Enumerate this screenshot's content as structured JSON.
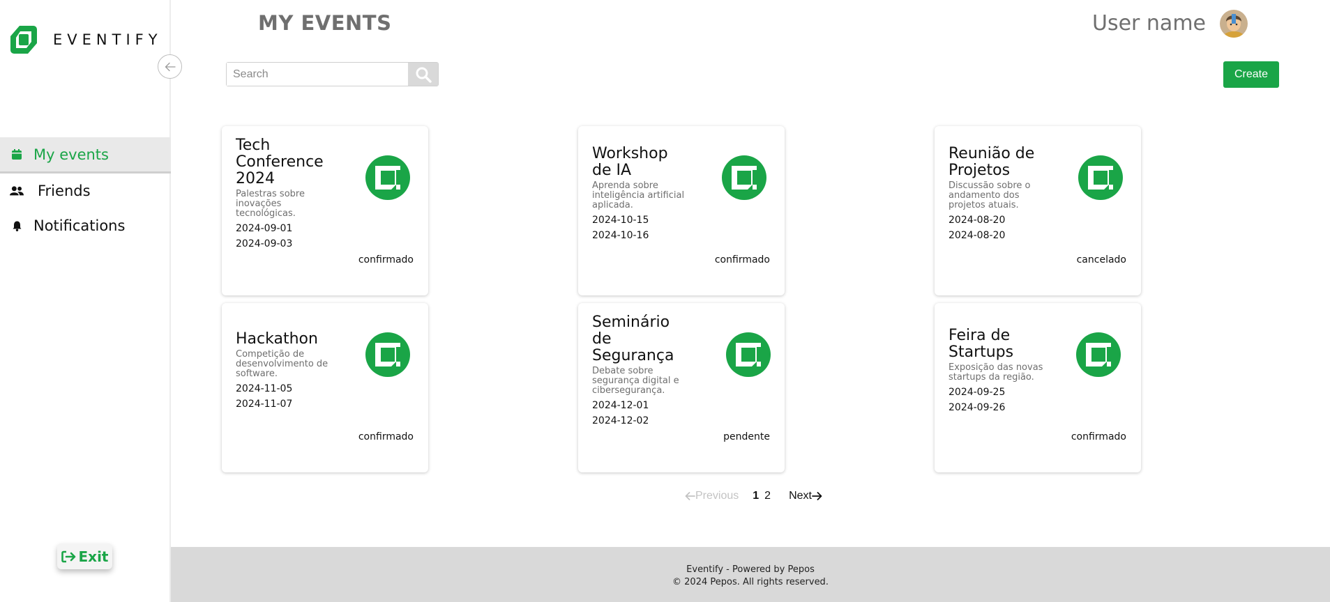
{
  "app": {
    "name": "EVENTIFY"
  },
  "colors": {
    "accent": "#1aa547",
    "footer_bg": "#d9d9d9",
    "active_nav_bg": "#e9e9e9"
  },
  "sidebar": {
    "items": [
      {
        "label": "My events",
        "icon": "calendar-icon",
        "active": true
      },
      {
        "label": "Friends",
        "icon": "users-icon",
        "active": false
      },
      {
        "label": "Notifications",
        "icon": "bell-icon",
        "active": false
      }
    ],
    "exit_label": "Exit"
  },
  "header": {
    "title": "MY EVENTS",
    "user_name": "User name"
  },
  "search": {
    "placeholder": "Search",
    "value": ""
  },
  "create_label": "Create",
  "events": [
    {
      "title": "Tech Conference 2024",
      "description": "Palestras sobre inovações tecnológicas.",
      "start": "2024-09-01",
      "end": "2024-09-03",
      "status": "confirmado"
    },
    {
      "title": "Workshop de IA",
      "description": "Aprenda sobre inteligência artificial aplicada.",
      "start": "2024-10-15",
      "end": "2024-10-16",
      "status": "confirmado"
    },
    {
      "title": "Reunião de Projetos",
      "description": "Discussão sobre o andamento dos projetos atuais.",
      "start": "2024-08-20",
      "end": "2024-08-20",
      "status": "cancelado"
    },
    {
      "title": "Hackathon",
      "description": "Competição de desenvolvimento de software.",
      "start": "2024-11-05",
      "end": "2024-11-07",
      "status": "confirmado"
    },
    {
      "title": "Seminário de Segurança",
      "description": "Debate sobre segurança digital e cibersegurança.",
      "start": "2024-12-01",
      "end": "2024-12-02",
      "status": "pendente"
    },
    {
      "title": "Feira de Startups",
      "description": "Exposição das novas startups da região.",
      "start": "2024-09-25",
      "end": "2024-09-26",
      "status": "confirmado"
    }
  ],
  "pagination": {
    "previous_label": "Previous",
    "next_label": "Next",
    "pages": [
      "1",
      "2"
    ],
    "current": "1"
  },
  "footer": {
    "line1": "Eventify - Powered by Pepos",
    "line2": "© 2024 Pepos. All rights reserved."
  }
}
